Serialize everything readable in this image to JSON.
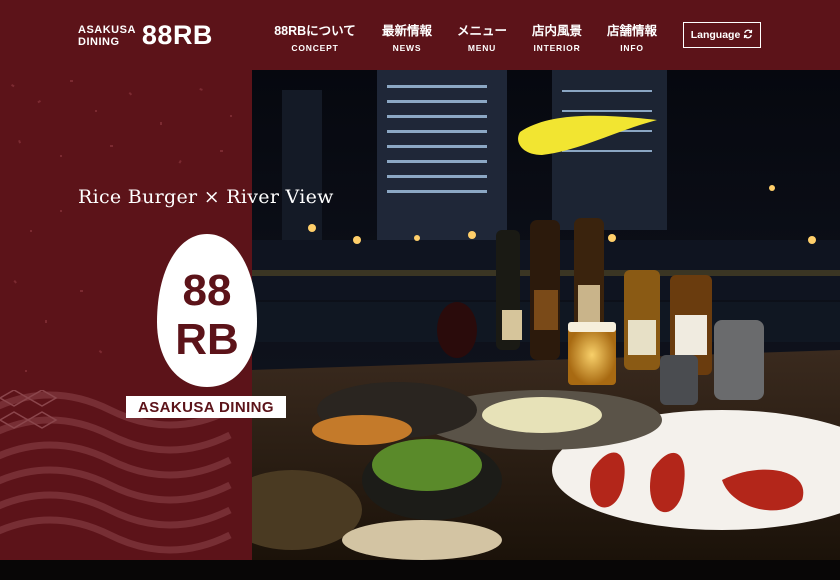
{
  "header": {
    "logo": {
      "line1": "ASAKUSA",
      "line2": "DINING",
      "name": "88RB"
    },
    "nav": [
      {
        "ja": "88RBについて",
        "en": "CONCEPT"
      },
      {
        "ja": "最新情報",
        "en": "NEWS"
      },
      {
        "ja": "メニュー",
        "en": "MENU"
      },
      {
        "ja": "店内風景",
        "en": "INTERIOR"
      },
      {
        "ja": "店舗情報",
        "en": "INFO"
      }
    ],
    "language_label": "Language"
  },
  "hero": {
    "tagline": "Rice Burger × River View",
    "brand_top": "88",
    "brand_bottom": "RB",
    "brand_label": "ASAKUSA DINING"
  },
  "colors": {
    "maroon": "#5c1319",
    "white": "#ffffff"
  },
  "icons": {
    "language": "refresh-icon"
  }
}
